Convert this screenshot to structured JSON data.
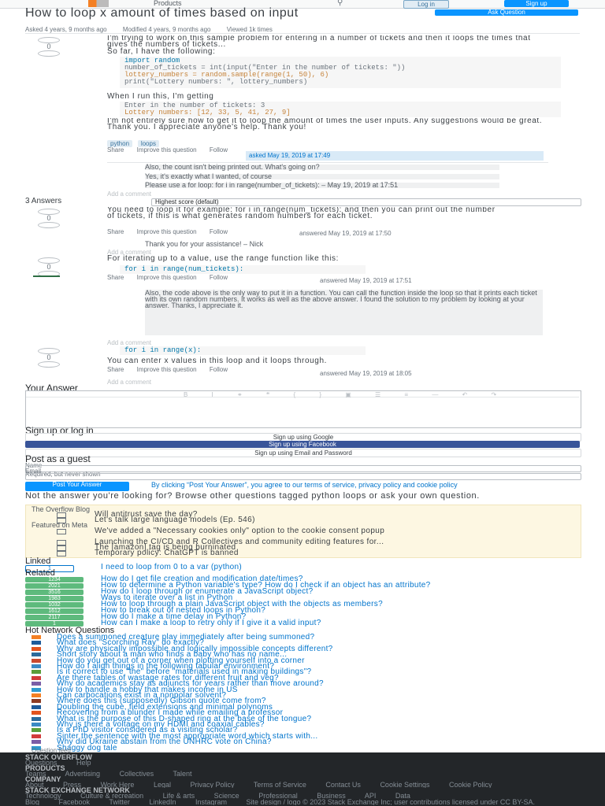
{
  "topbar": {
    "products_label": "Products",
    "login_label": "Log in",
    "signup_label": "Sign up"
  },
  "question": {
    "title": "How to loop x amount of times based on input",
    "ask_label": "Ask Question",
    "meta": [
      "Asked 4 years, 9 months ago",
      "Modified 4 years, 9 months ago",
      "Viewed 1k times"
    ],
    "score": "0",
    "body_p1": "I'm trying to work on this sample problem for entering in a number of tickets and then it loops the times that gives the numbers of tickets...",
    "body_p1b": "So far, I have the following:",
    "code_lines": [
      "import random",
      "number_of_tickets = int(input(\"Enter in the number of tickets: \"))",
      "lottery_numbers = random.sample(range(1, 50), 6)",
      "print(\"Lottery numbers: \", lottery_numbers)"
    ],
    "body_p2": "When I run this, I'm getting",
    "code2_lines": [
      "Enter in the number of tickets: 3",
      "Lottery numbers: [12, 33, 5, 41, 27, 9]"
    ],
    "body_p3": "I'm not entirely sure how to get it to loop the amount of times the user inputs. Any suggestions would be great. Thank you. I appreciate anyone's help. Thank you!",
    "tags": [
      "python",
      "loops"
    ],
    "actions": [
      "Share",
      "Improve this question",
      "Follow"
    ],
    "asked_card": "asked May 19, 2019 at 17:49",
    "comments": [
      "Also, the count isn't being printed out. What's going on?",
      "Yes, it's exactly what I wanted, of course",
      "Please use a for loop: for i in range(number_of_tickets): – May 19, 2019 at 17:51"
    ],
    "add_comment": "Add a comment"
  },
  "answers": {
    "count_label": "3 Answers",
    "sort_label": "Highest score (default)",
    "a1": {
      "score": "0",
      "text": "You need to loop it for example: for i in range(num_tickets): and then you can print out the number of tickets, if this is what generates random numbers for each ticket.",
      "card": "answered May 19, 2019 at 17:50",
      "comment": "Thank you for your assistance! – Nick",
      "add_comment": "Add a comment"
    },
    "a2": {
      "score": "0",
      "text": "For iterating up to a value, use the range function like this:",
      "code": "for i in range(num_tickets):",
      "card": "answered May 19, 2019 at 17:51",
      "comments": "Also, the code above is the only way to put it in a function. You can call the function inside the loop so that it prints each ticket with its own random numbers. It works as well as the above answer. I found the solution to my problem by looking at your answer. Thanks, I appreciate it.",
      "add_comment": "Add a comment"
    },
    "a3": {
      "score": "0",
      "code": "for i in range(x):",
      "text": "You can enter x values in this loop and it loops through.",
      "card": "answered May 19, 2019 at 18:05",
      "add_comment": "Add a comment"
    }
  },
  "your_answer": {
    "heading": "Your Answer",
    "toolbar_glyphs": "B I ⚭ ❝ { } ▣ ☰ ≡ ― ↶ ↷",
    "signup_heading": "Sign up or log in",
    "google_label": "Sign up using Google",
    "facebook_label": "Sign up using Facebook",
    "email_label": "Sign up using Email and Password",
    "guest_heading": "Post as a guest",
    "name_label": "Name",
    "email_field_label": "Email",
    "email_hint": "Required, but never shown",
    "post_label": "Post Your Answer",
    "terms_text": "By clicking “Post Your Answer”, you agree to our terms of service, privacy policy and cookie policy",
    "not_answer": "Not the answer you're looking for? Browse other questions tagged python loops or ask your own question."
  },
  "blog": {
    "heading": "The Overflow Blog",
    "items": [
      "Will antitrust save the day?",
      "Let's talk large language models (Ep. 546)"
    ],
    "featured_heading": "Featured on Meta",
    "featured": [
      "We've added a \"Necessary cookies only\" option to the cookie consent popup",
      "Launching the CI/CD and R Collectives and community editing features for...",
      "The [amazon] tag is being burninated",
      "Temporary policy: ChatGPT is banned"
    ]
  },
  "linked": {
    "heading": "Linked",
    "items": [
      {
        "count": "1",
        "text": "I need to loop from 0 to a var (python)"
      }
    ]
  },
  "related": {
    "heading": "Related",
    "items": [
      {
        "count": "1234",
        "text": "How do I get file creation and modification date/times?"
      },
      {
        "count": "2021",
        "text": "How to determine a Python variable's type? How do I check if an object has an attribute?"
      },
      {
        "count": "3516",
        "text": "How do I loop through or enumerate a JavaScript object?"
      },
      {
        "count": "1983",
        "text": "Ways to iterate over a list in Python"
      },
      {
        "count": "1032",
        "text": "How to loop through a plain JavaScript object with the objects as members?"
      },
      {
        "count": "1612",
        "text": "How to break out of nested loops in Python?"
      },
      {
        "count": "2117",
        "text": "How do I make a time delay in Python?"
      },
      {
        "count": "1",
        "text": "How can I make a loop to retry only if I give it a valid input?"
      }
    ]
  },
  "hnq": {
    "heading": "Hot Network Questions",
    "items": [
      "Does a summoned creature play immediately after being summoned?",
      "What does \"Scorching Ray\" do exactly?",
      "Why are physically impossible and logically impossible concepts different?",
      "Short story about a man who finds a baby who has no name...",
      "How do you get out of a corner when plotting yourself into a corner",
      "How do I align things in the following tabular environment?",
      "Is it correct to use \"the\" before \"materials used in making buildings\"?",
      "Are there tables of wastage rates for different fruit and veg?",
      "Why do academics stay as adjuncts for years rather than move around?",
      "How to handle a hobby that makes income in US",
      "Can carbocations exist in a nonpolar solvent?",
      "Where does this (supposedly) Gibson quote come from?",
      "Doubling the cube, field extensions and minimal polynoms",
      "Recovering from a blunder I made while emailing a professor",
      "What is the purpose of this D-shaped ring at the base of the tongue?",
      "Why is there a voltage on my HDMI and coaxial cables?",
      "Is a PhD visitor considered as a visiting scholar?",
      "Sinter the sentence with the most appropriate word which starts with...",
      "Why did Ukraine abstain from the UNHRC vote on China?",
      "Shaggy dog tale"
    ],
    "icon_colors": [
      "#f48024",
      "#1e5b9a",
      "#e2531d",
      "#2b6a9b",
      "#c9492e",
      "#3b8ac4",
      "#5a9e3a",
      "#d13b3b",
      "#7b5ea7",
      "#2f9acf",
      "#f48024",
      "#8d3c23",
      "#1e5b9a",
      "#e2531d",
      "#2b6a9b",
      "#3b8ac4",
      "#5a9e3a",
      "#d13b3b",
      "#7b5ea7",
      "#2f9acf"
    ],
    "feed_label": "Question feed"
  },
  "footer": {
    "brand": "STACK OVERFLOW",
    "brand_links": [
      "Questions",
      "Help"
    ],
    "products_h": "PRODUCTS",
    "products_links": [
      "Teams",
      "Advertising",
      "Collectives",
      "Talent"
    ],
    "company_h": "COMPANY",
    "company_links": [
      "About",
      "Press",
      "Work Here",
      "Legal",
      "Privacy Policy",
      "Terms of Service",
      "Contact Us",
      "Cookie Settings",
      "Cookie Policy"
    ],
    "network_h": "STACK EXCHANGE NETWORK",
    "network_links": [
      "Technology",
      "Culture & recreation",
      "Life & arts",
      "Science",
      "Professional",
      "Business",
      "API",
      "Data"
    ],
    "social_links": [
      "Blog",
      "Facebook",
      "Twitter",
      "LinkedIn",
      "Instagram"
    ],
    "copyright": "Site design / logo © 2023 Stack Exchange Inc; user contributions licensed under CC BY-SA."
  }
}
